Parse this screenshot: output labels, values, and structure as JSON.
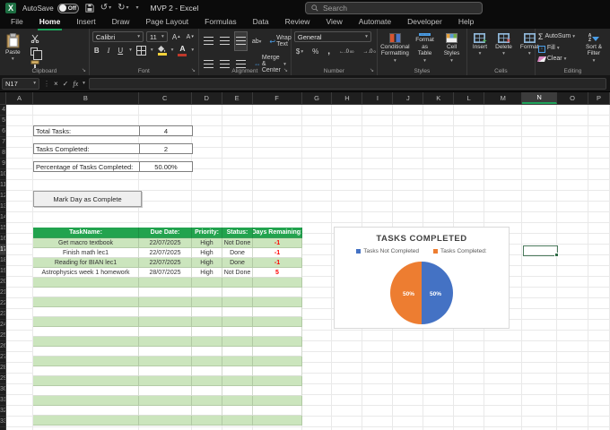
{
  "titlebar": {
    "autosave_label": "AutoSave",
    "autosave_state": "Off",
    "title": "MVP 2  -  Excel",
    "search_placeholder": "Search"
  },
  "tabs": [
    "File",
    "Home",
    "Insert",
    "Draw",
    "Page Layout",
    "Formulas",
    "Data",
    "Review",
    "View",
    "Automate",
    "Developer",
    "Help"
  ],
  "active_tab": "Home",
  "ribbon": {
    "clipboard": {
      "label": "Clipboard",
      "paste": "Paste"
    },
    "font": {
      "label": "Font",
      "font_name": "Calibri",
      "font_size": "11",
      "bold": "B",
      "italic": "I",
      "underline": "U"
    },
    "alignment": {
      "label": "Alignment",
      "wrap_text": "Wrap Text",
      "merge_center": "Merge & Center"
    },
    "number": {
      "label": "Number",
      "format": "General",
      "currency": "$",
      "percent": "%",
      "comma": ","
    },
    "styles": {
      "label": "Styles",
      "conditional": "Conditional Formatting",
      "format_table": "Format as Table",
      "cell_styles": "Cell Styles"
    },
    "cells": {
      "label": "Cells",
      "insert": "Insert",
      "delete": "Delete",
      "format": "Format"
    },
    "editing": {
      "label": "Editing",
      "autosum": "AutoSum",
      "fill": "Fill",
      "clear": "Clear",
      "sort_filter": "Sort & Filter"
    }
  },
  "formula_bar": {
    "name_box": "N17",
    "formula": ""
  },
  "grid": {
    "columns": [
      "A",
      "B",
      "C",
      "D",
      "E",
      "F",
      "G",
      "H",
      "I",
      "J",
      "K",
      "L",
      "M",
      "N",
      "O",
      "P"
    ],
    "selected_column": "N",
    "selected_cell": "N17",
    "row_count": 30,
    "selected_row_index": 13
  },
  "stats": {
    "rows": [
      {
        "label": "Total Tasks:",
        "value": "4"
      },
      {
        "label": "Tasks Completed:",
        "value": "2"
      },
      {
        "label": "Percentage of Tasks Completed:",
        "value": "50.00%"
      }
    ],
    "button_label": "Mark Day as Complete"
  },
  "task_table": {
    "headers": [
      "TaskName:",
      "Due Date:",
      "Priority:",
      "Status:",
      "Days Remaining:"
    ],
    "rows": [
      {
        "task": "Get macro textbook",
        "due": "22/07/2025",
        "priority": "High",
        "status": "Not Done",
        "days": "-1"
      },
      {
        "task": "Finish math lec1",
        "due": "22/07/2025",
        "priority": "High",
        "status": "Done",
        "days": "-1"
      },
      {
        "task": "Reading for BIAN lec1",
        "due": "22/07/2025",
        "priority": "High",
        "status": "Done",
        "days": "-1"
      },
      {
        "task": "Astrophysics week 1 homework",
        "due": "28/07/2025",
        "priority": "High",
        "status": "Not Done",
        "days": "5"
      }
    ],
    "empty_row_count": 15
  },
  "chart_data": {
    "type": "pie",
    "title": "TASKS COMPLETED",
    "legend_position": "top",
    "slices": [
      {
        "label": "Tasks Not Completed",
        "value": 50,
        "data_label": "50%",
        "color": "#4472C4"
      },
      {
        "label": "Tasks Completed:",
        "value": 50,
        "data_label": "50%",
        "color": "#ED7D31"
      }
    ]
  },
  "colors": {
    "accent_green": "#1EA35B",
    "table_header_green": "#22A34E",
    "band_green": "#CBE5BD",
    "pie_blue": "#4472C4",
    "pie_orange": "#ED7D31",
    "days_red": "#FF0000",
    "fill_color_swatch": "#F3D23A",
    "font_color_swatch": "#C0392B"
  }
}
